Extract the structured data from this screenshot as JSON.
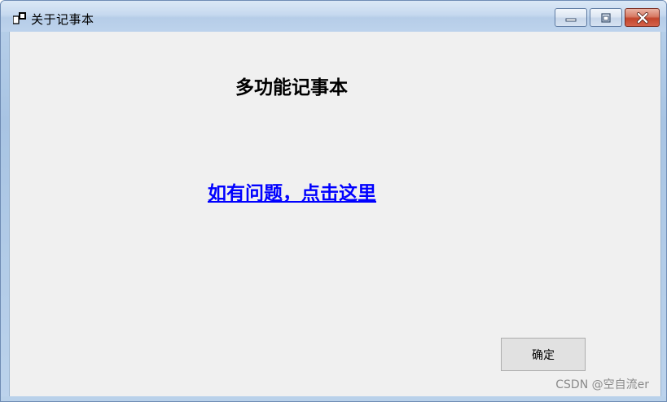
{
  "window": {
    "title": "关于记事本"
  },
  "main": {
    "heading": "多功能记事本",
    "help_link": "如有问题，点击这里",
    "ok_label": "确定"
  },
  "watermark": "CSDN @空自流er",
  "colors": {
    "link": "#0000ff",
    "client_bg": "#f0f0f0",
    "close_button": "#c2452c"
  }
}
